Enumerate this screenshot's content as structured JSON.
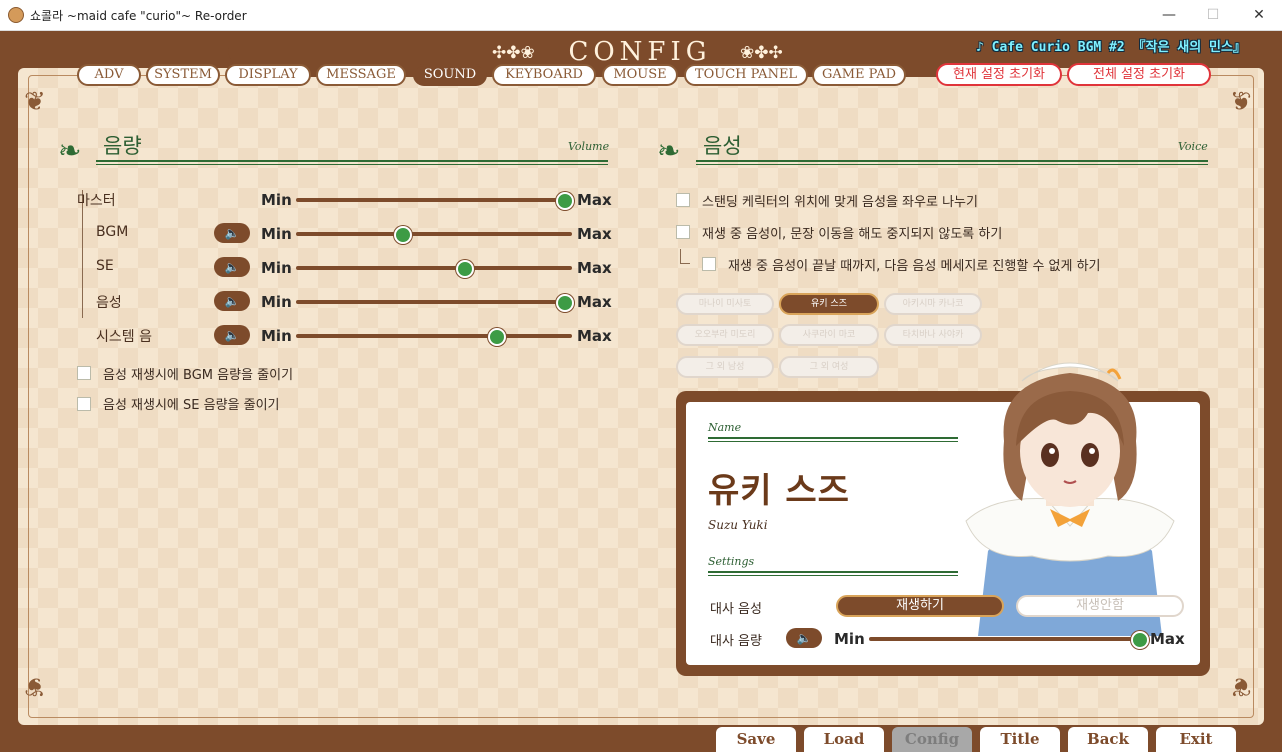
{
  "window": {
    "title": "쇼콜라 ~maid cafe \"curio\"~ Re-order",
    "minimize": "—",
    "maximize": "☐",
    "close": "✕"
  },
  "header": {
    "title": "CONFIG",
    "ornament_left": "✣✤❀",
    "ornament_right": "❀✤✣",
    "bgm": "♪ Cafe Curio BGM #2 『작은 새의 민스』"
  },
  "tabs": [
    {
      "label": "ADV"
    },
    {
      "label": "SYSTEM"
    },
    {
      "label": "DISPLAY"
    },
    {
      "label": "MESSAGE"
    },
    {
      "label": "SOUND",
      "active": true
    },
    {
      "label": "KEYBOARD"
    },
    {
      "label": "MOUSE"
    },
    {
      "label": "TOUCH PANEL"
    },
    {
      "label": "GAME PAD"
    }
  ],
  "reset": {
    "current": "현재 설정 초기화",
    "all": "전체 설정 초기화"
  },
  "volume": {
    "title": "음량",
    "subtitle": "Volume",
    "min_label": "Min",
    "max_label": "Max",
    "rows": [
      {
        "label": "마스터",
        "level": 1.0,
        "speaker": false
      },
      {
        "label": "BGM",
        "level": 0.38,
        "speaker": true
      },
      {
        "label": "SE",
        "level": 0.62,
        "speaker": true
      },
      {
        "label": "음성",
        "level": 1.0,
        "speaker": true
      },
      {
        "label": "시스템 음",
        "level": 0.74,
        "speaker": true
      }
    ],
    "options": [
      {
        "label": "음성 재생시에 BGM 음량을 줄이기",
        "checked": false
      },
      {
        "label": "음성 재생시에 SE 음량을 줄이기",
        "checked": false
      }
    ]
  },
  "voice": {
    "title": "음성",
    "subtitle": "Voice",
    "options": [
      {
        "label": "스탠딩 케릭터의 위치에 맞게 음성을 좌우로 나누기",
        "checked": false
      },
      {
        "label": "재생 중 음성이, 문장 이동을 해도 중지되지 않도록 하기",
        "checked": false
      },
      {
        "label": "재생 중 음성이 끝날 때까지, 다음 음성 메세지로 진행할 수 없게 하기",
        "checked": false
      }
    ],
    "characters": [
      {
        "label": "마나이 미사토",
        "active": false
      },
      {
        "label": "유키 스즈",
        "active": true
      },
      {
        "label": "아키시마 카나코",
        "active": false
      },
      {
        "label": "오오부라 미도리",
        "active": false
      },
      {
        "label": "사쿠라이 마코",
        "active": false
      },
      {
        "label": "타치바나 사야카",
        "active": false
      },
      {
        "label": "그 외 남성",
        "active": false
      },
      {
        "label": "그 외 여성",
        "active": false
      }
    ]
  },
  "card": {
    "name_label": "Name",
    "name": "유키 스즈",
    "romanized": "Suzu Yuki",
    "settings_label": "Settings",
    "dialogue_voice_label": "대사 음성",
    "play_label": "재생하기",
    "noplay_label": "재생안함",
    "dialogue_volume_label": "대사 음량",
    "volume_level": 1.0
  },
  "bottom": [
    {
      "label": "Save",
      "active": false
    },
    {
      "label": "Load",
      "active": false
    },
    {
      "label": "Config",
      "active": true
    },
    {
      "label": "Title",
      "active": false
    },
    {
      "label": "Back",
      "active": false
    },
    {
      "label": "Exit",
      "active": false
    }
  ],
  "icons": {
    "section": "leaf-swirl-icon",
    "speaker": "speaker-icon",
    "corner": "corner-flourish-icon"
  },
  "colors": {
    "brown": "#7d4b2b",
    "green": "#2e6b34",
    "knob": "#3d9b45",
    "reset_red": "#e0343a"
  }
}
